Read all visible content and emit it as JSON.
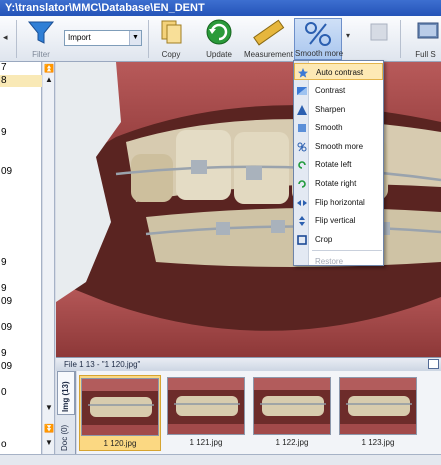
{
  "window": {
    "title": "Y:\\translator\\MMC\\Database\\EN_DENT"
  },
  "toolbar": {
    "filter_label": "Filter",
    "import_value": "Import",
    "copy_label": "Copy",
    "update_label": "Update",
    "measurement_label": "Measurement",
    "smooth_more_label": "Smooth more",
    "full_label": "Full S"
  },
  "left_list": {
    "rows": [
      "7",
      "8",
      "",
      "",
      "",
      "9",
      "",
      "",
      "09",
      "",
      "",
      "",
      "",
      "",
      "",
      "9",
      "",
      "9",
      "09",
      "",
      "09",
      "",
      "9",
      "09",
      "",
      "0",
      "",
      "",
      "",
      "o"
    ]
  },
  "menu": {
    "items": [
      {
        "label": "Auto contrast",
        "icon": "star-icon",
        "highlighted": true,
        "disabled": false
      },
      {
        "label": "Contrast",
        "icon": "contrast-icon",
        "highlighted": false,
        "disabled": false
      },
      {
        "label": "Sharpen",
        "icon": "sharpen-icon",
        "highlighted": false,
        "disabled": false
      },
      {
        "label": "Smooth",
        "icon": "smooth-icon",
        "highlighted": false,
        "disabled": false
      },
      {
        "label": "Smooth more",
        "icon": "smooth-more-icon",
        "highlighted": false,
        "disabled": false
      },
      {
        "label": "Rotate left",
        "icon": "rotate-left-icon",
        "highlighted": false,
        "disabled": false
      },
      {
        "label": "Rotate right",
        "icon": "rotate-right-icon",
        "highlighted": false,
        "disabled": false
      },
      {
        "label": "Flip horizontal",
        "icon": "flip-horizontal-icon",
        "highlighted": false,
        "disabled": false
      },
      {
        "label": "Flip vertical",
        "icon": "flip-vertical-icon",
        "highlighted": false,
        "disabled": false
      },
      {
        "label": "Crop",
        "icon": "crop-icon",
        "highlighted": false,
        "disabled": false
      },
      {
        "label": "Restore",
        "icon": "",
        "highlighted": false,
        "disabled": true
      }
    ]
  },
  "thumbs_panel": {
    "header": "File 1 13  -  \"1 120.jpg\"",
    "tab_img": "Img (13)",
    "tab_doc": "Doc (0)",
    "items": [
      {
        "caption": "1 120.jpg",
        "selected": true
      },
      {
        "caption": "1 121.jpg",
        "selected": false
      },
      {
        "caption": "1 122.jpg",
        "selected": false
      },
      {
        "caption": "1 123.jpg",
        "selected": false
      }
    ]
  },
  "colors": {
    "title_bar": "#2453b8",
    "menu_highlight": "#fde9b5",
    "selection": "#fbd882"
  }
}
